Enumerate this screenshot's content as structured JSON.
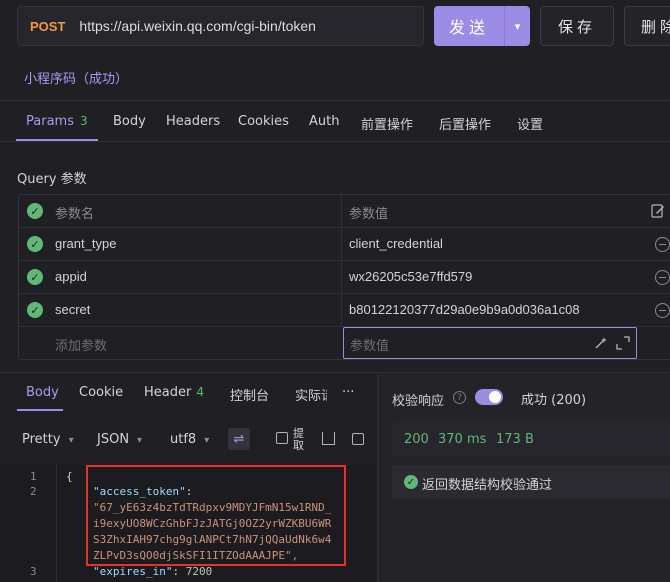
{
  "request": {
    "method": "POST",
    "url": "https://api.weixin.qq.com/cgi-bin/token",
    "send_label": "发送",
    "save_label": "保存",
    "delete_label": "删除",
    "title": "小程序码（成功）"
  },
  "request_tabs": [
    {
      "label": "Params",
      "count": "3"
    },
    {
      "label": "Body"
    },
    {
      "label": "Headers"
    },
    {
      "label": "Cookies"
    },
    {
      "label": "Auth"
    },
    {
      "label": "前置操作"
    },
    {
      "label": "后置操作"
    },
    {
      "label": "设置"
    }
  ],
  "query": {
    "title": "Query 参数",
    "header": {
      "key": "参数名",
      "value": "参数值"
    },
    "rows": [
      {
        "key": "grant_type",
        "value": "client_credential"
      },
      {
        "key": "appid",
        "value": "wx26205c53e7ffd579"
      },
      {
        "key": "secret",
        "value": "b80122120377d29a0e9b9a0d036a1c08"
      }
    ],
    "new_key_placeholder": "添加参数",
    "new_value_placeholder": "参数值"
  },
  "response_tabs": [
    {
      "label": "Body"
    },
    {
      "label": "Cookie"
    },
    {
      "label": "Header",
      "count": "4"
    },
    {
      "label": "控制台"
    },
    {
      "label": "实际请"
    },
    {
      "label": "···"
    }
  ],
  "format": {
    "pretty": "Pretty",
    "json": "JSON",
    "encoding": "utf8",
    "extract": "提取"
  },
  "code": {
    "lines": [
      {
        "n": "1",
        "text": "{"
      },
      {
        "n": "2",
        "key": "\"access_token\"",
        "colon": ":",
        "value_lines": [
          "\"67_yE63z4bzTdTRdpxv9MDYJFmN15w1RND_",
          "i9exyUO8WCzGhbFJzJATGj0OZ2yrWZKBU6WR",
          "S3ZhxIAH97chg9glANPCt7hN7jQQaUdNk6w4",
          "ZLPvD3sQO0djSkSFI1ITZOdAAAJPE\","
        ]
      },
      {
        "n": "3",
        "key": "\"expires_in\"",
        "colon": ":",
        "value": "7200"
      }
    ]
  },
  "validation": {
    "label": "校验响应",
    "status": "成功 (200)",
    "code": "200",
    "time": "370 ms",
    "size": "173 B",
    "message": "返回数据结构校验通过"
  },
  "colors": {
    "accent": "#9d8ce5",
    "success": "#5fb878",
    "method": "#f39b3c",
    "highlight": "#e5322b"
  }
}
